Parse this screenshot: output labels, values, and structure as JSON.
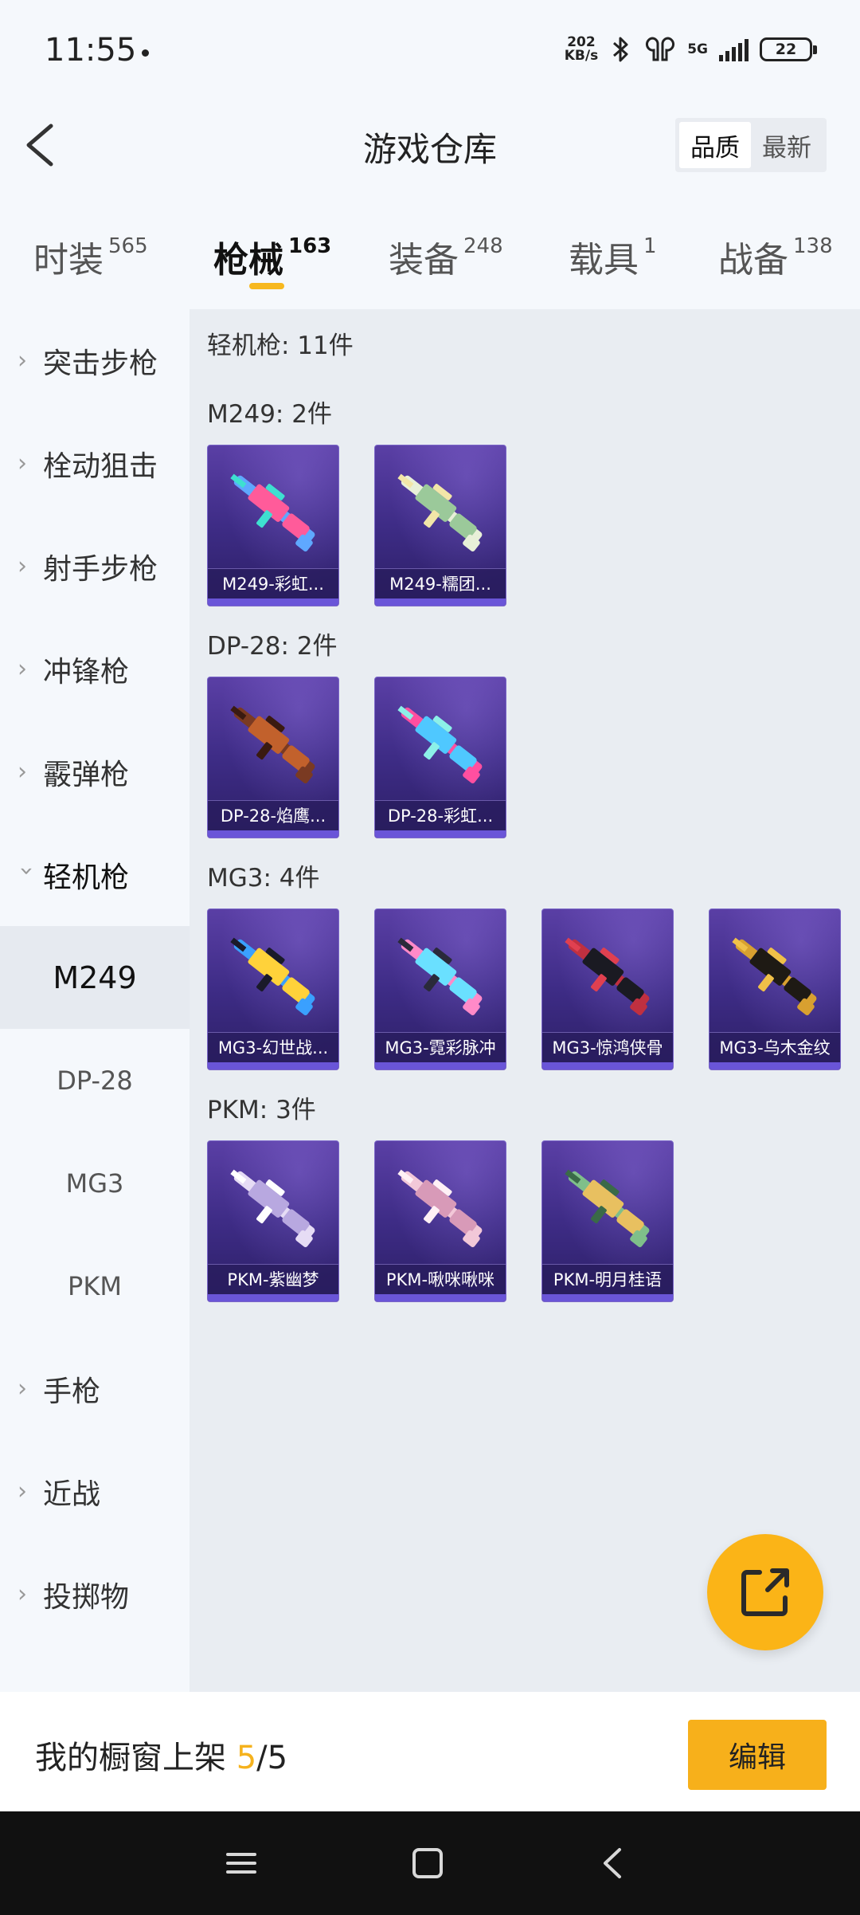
{
  "status_bar": {
    "time": "11:55",
    "net_speed_value": "202",
    "net_speed_unit": "KB/s",
    "network": "5G",
    "battery": "22"
  },
  "header": {
    "title": "游戏仓库",
    "sort_options": [
      {
        "label": "品质",
        "active": true
      },
      {
        "label": "最新",
        "active": false
      }
    ]
  },
  "tabs": [
    {
      "label": "时装",
      "count": "565"
    },
    {
      "label": "枪械",
      "count": "163",
      "active": true
    },
    {
      "label": "装备",
      "count": "248"
    },
    {
      "label": "载具",
      "count": "1"
    },
    {
      "label": "战备",
      "count": "138"
    }
  ],
  "sidebar": {
    "categories_top": [
      "突击步枪",
      "栓动狙击",
      "射手步枪",
      "冲锋枪",
      "霰弹枪"
    ],
    "open_category": "轻机枪",
    "subitems": [
      "M249",
      "DP-28",
      "MG3",
      "PKM"
    ],
    "active_subitem": "M249",
    "categories_bottom": [
      "手枪",
      "近战",
      "投掷物"
    ]
  },
  "content": {
    "summary": "轻机枪: 11件",
    "groups": [
      {
        "heading": "M249: 2件",
        "items": [
          {
            "name": "M249-彩虹...",
            "colors": [
              "#5fa8ff",
              "#ff5b9a",
              "#3ee0d0"
            ]
          },
          {
            "name": "M249-糯团...",
            "colors": [
              "#e8f0d8",
              "#9bc99a",
              "#f2e6a8"
            ]
          }
        ]
      },
      {
        "heading": "DP-28: 2件",
        "items": [
          {
            "name": "DP-28-焰鹰...",
            "colors": [
              "#7a3a22",
              "#c2612c",
              "#3a1a10"
            ]
          },
          {
            "name": "DP-28-彩虹...",
            "colors": [
              "#ff4fa0",
              "#4fc8ff",
              "#8cf0e8"
            ]
          }
        ]
      },
      {
        "heading": "MG3: 4件",
        "items": [
          {
            "name": "MG3-幻世战...",
            "colors": [
              "#3aa0ff",
              "#ffd23a",
              "#1a1a2a"
            ]
          },
          {
            "name": "MG3-霓彩脉冲",
            "colors": [
              "#ff8ac8",
              "#6ae0ff",
              "#2a2a3a"
            ]
          },
          {
            "name": "MG3-惊鸿侠骨",
            "colors": [
              "#c03040",
              "#1a1a22",
              "#e04050"
            ]
          },
          {
            "name": "MG3-乌木金纹",
            "colors": [
              "#d8a030",
              "#1e1a14",
              "#f0c048"
            ]
          }
        ]
      },
      {
        "heading": "PKM: 3件",
        "items": [
          {
            "name": "PKM-紫幽梦",
            "colors": [
              "#e6dcf5",
              "#b8a8e0",
              "#ffffff"
            ]
          },
          {
            "name": "PKM-啾咪啾咪",
            "colors": [
              "#f2c8d8",
              "#d89ab8",
              "#fff0f5"
            ]
          },
          {
            "name": "PKM-明月桂语",
            "colors": [
              "#7fbf8a",
              "#e8c060",
              "#3a6a48"
            ]
          }
        ]
      }
    ]
  },
  "bottom_bar": {
    "label": "我的橱窗上架",
    "current": "5",
    "separator": "/",
    "total": "5",
    "edit_label": "编辑"
  },
  "icons": {
    "back": "back-arrow-icon",
    "share": "share-external-icon",
    "chevron": "chevron-right-icon",
    "chevron_open": "chevron-down-icon"
  }
}
